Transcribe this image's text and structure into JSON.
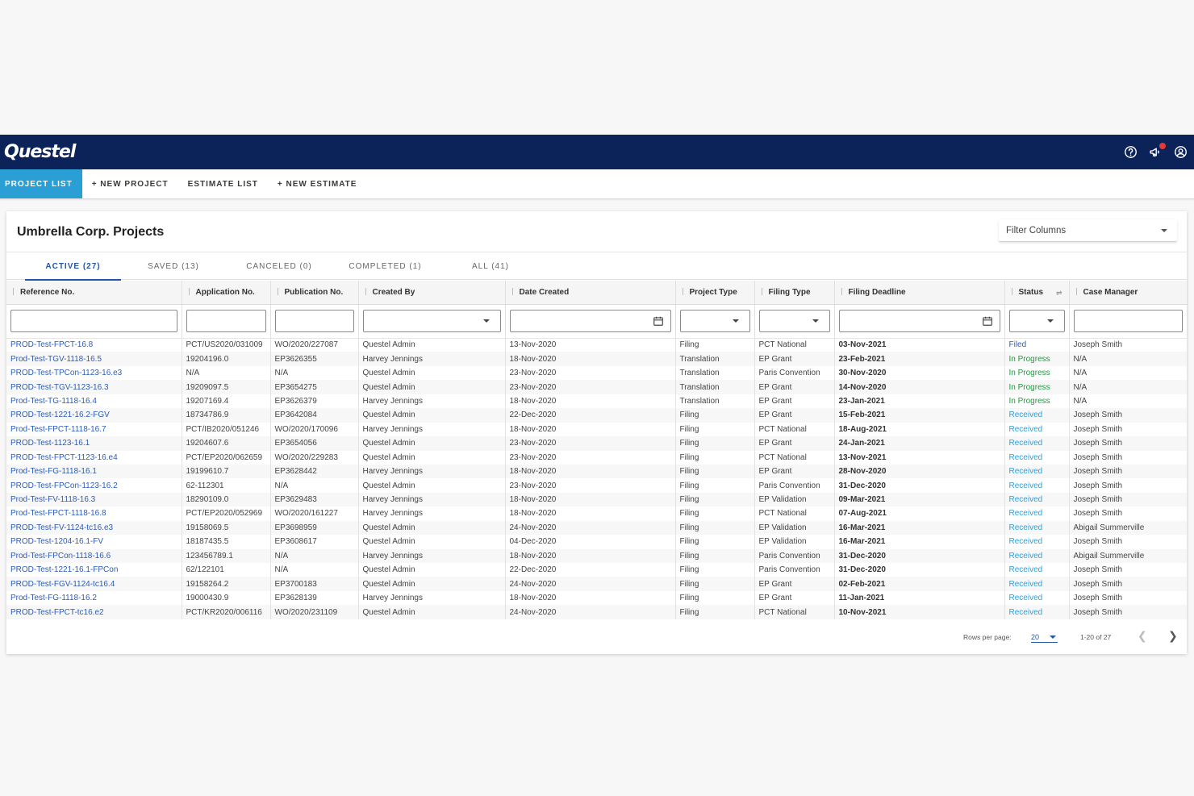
{
  "app": {
    "logo": "Questel"
  },
  "topbar": {
    "help_icon": "help-circle-icon",
    "announce_icon": "megaphone-icon",
    "account_icon": "account-circle-icon"
  },
  "nav": {
    "items": [
      {
        "label": "Project List",
        "active": true
      },
      {
        "label": "+ New Project",
        "active": false
      },
      {
        "label": "Estimate List",
        "active": false
      },
      {
        "label": "+ New Estimate",
        "active": false
      }
    ]
  },
  "page": {
    "title": "Umbrella Corp. Projects",
    "filter_columns": "Filter Columns"
  },
  "tabs": [
    {
      "label": "Active (27)",
      "active": true
    },
    {
      "label": "Saved (13)",
      "active": false
    },
    {
      "label": "Canceled (0)",
      "active": false
    },
    {
      "label": "Completed (1)",
      "active": false
    },
    {
      "label": "All (41)",
      "active": false
    }
  ],
  "columns": [
    "Reference No.",
    "Application No.",
    "Publication No.",
    "Created By",
    "Date Created",
    "Project Type",
    "Filing Type",
    "Filing Deadline",
    "Status",
    "Case Manager"
  ],
  "rows": [
    [
      "PROD-Test-FPCT-16.8",
      "PCT/US2020/031009",
      "WO/2020/227087",
      "Questel Admin",
      "13-Nov-2020",
      "Filing",
      "PCT National",
      "03-Nov-2021",
      "Filed",
      "Joseph Smith"
    ],
    [
      "Prod-Test-TGV-1118-16.5",
      "19204196.0",
      "EP3626355",
      "Harvey Jennings",
      "18-Nov-2020",
      "Translation",
      "EP Grant",
      "23-Feb-2021",
      "In Progress",
      "N/A"
    ],
    [
      "PROD-Test-TPCon-1123-16.e3",
      "N/A",
      "N/A",
      "Questel Admin",
      "23-Nov-2020",
      "Translation",
      "Paris Convention",
      "30-Nov-2020",
      "In Progress",
      "N/A"
    ],
    [
      "PROD-Test-TGV-1123-16.3",
      "19209097.5",
      "EP3654275",
      "Questel Admin",
      "23-Nov-2020",
      "Translation",
      "EP Grant",
      "14-Nov-2020",
      "In Progress",
      "N/A"
    ],
    [
      "Prod-Test-TG-1118-16.4",
      "19207169.4",
      "EP3626379",
      "Harvey Jennings",
      "18-Nov-2020",
      "Translation",
      "EP Grant",
      "23-Jan-2021",
      "In Progress",
      "N/A"
    ],
    [
      "PROD-Test-1221-16.2-FGV",
      "18734786.9",
      "EP3642084",
      "Questel Admin",
      "22-Dec-2020",
      "Filing",
      "EP Grant",
      "15-Feb-2021",
      "Received",
      "Joseph Smith"
    ],
    [
      "Prod-Test-FPCT-1118-16.7",
      "PCT/IB2020/051246",
      "WO/2020/170096",
      "Harvey Jennings",
      "18-Nov-2020",
      "Filing",
      "PCT National",
      "18-Aug-2021",
      "Received",
      "Joseph Smith"
    ],
    [
      "PROD-Test-1123-16.1",
      "19204607.6",
      "EP3654056",
      "Questel Admin",
      "23-Nov-2020",
      "Filing",
      "EP Grant",
      "24-Jan-2021",
      "Received",
      "Joseph Smith"
    ],
    [
      "PROD-Test-FPCT-1123-16.e4",
      "PCT/EP2020/062659",
      "WO/2020/229283",
      "Questel Admin",
      "23-Nov-2020",
      "Filing",
      "PCT National",
      "13-Nov-2021",
      "Received",
      "Joseph Smith"
    ],
    [
      "Prod-Test-FG-1118-16.1",
      "19199610.7",
      "EP3628442",
      "Harvey Jennings",
      "18-Nov-2020",
      "Filing",
      "EP Grant",
      "28-Nov-2020",
      "Received",
      "Joseph Smith"
    ],
    [
      "PROD-Test-FPCon-1123-16.2",
      "62-112301",
      "N/A",
      "Questel Admin",
      "23-Nov-2020",
      "Filing",
      "Paris Convention",
      "31-Dec-2020",
      "Received",
      "Joseph Smith"
    ],
    [
      "Prod-Test-FV-1118-16.3",
      "18290109.0",
      "EP3629483",
      "Harvey Jennings",
      "18-Nov-2020",
      "Filing",
      "EP Validation",
      "09-Mar-2021",
      "Received",
      "Joseph Smith"
    ],
    [
      "Prod-Test-FPCT-1118-16.8",
      "PCT/EP2020/052969",
      "WO/2020/161227",
      "Harvey Jennings",
      "18-Nov-2020",
      "Filing",
      "PCT National",
      "07-Aug-2021",
      "Received",
      "Joseph Smith"
    ],
    [
      "PROD-Test-FV-1124-tc16.e3",
      "19158069.5",
      "EP3698959",
      "Questel Admin",
      "24-Nov-2020",
      "Filing",
      "EP Validation",
      "16-Mar-2021",
      "Received",
      "Abigail Summerville"
    ],
    [
      "PROD-Test-1204-16.1-FV",
      "18187435.5",
      "EP3608617",
      "Questel Admin",
      "04-Dec-2020",
      "Filing",
      "EP Validation",
      "16-Mar-2021",
      "Received",
      "Joseph Smith"
    ],
    [
      "Prod-Test-FPCon-1118-16.6",
      "123456789.1",
      "N/A",
      "Harvey Jennings",
      "18-Nov-2020",
      "Filing",
      "Paris Convention",
      "31-Dec-2020",
      "Received",
      "Abigail Summerville"
    ],
    [
      "PROD-Test-1221-16.1-FPCon",
      "62/122101",
      "N/A",
      "Questel Admin",
      "22-Dec-2020",
      "Filing",
      "Paris Convention",
      "31-Dec-2020",
      "Received",
      "Joseph Smith"
    ],
    [
      "PROD-Test-FGV-1124-tc16.4",
      "19158264.2",
      "EP3700183",
      "Questel Admin",
      "24-Nov-2020",
      "Filing",
      "EP Grant",
      "02-Feb-2021",
      "Received",
      "Joseph Smith"
    ],
    [
      "Prod-Test-FG-1118-16.2",
      "19000430.9",
      "EP3628139",
      "Harvey Jennings",
      "18-Nov-2020",
      "Filing",
      "EP Grant",
      "11-Jan-2021",
      "Received",
      "Joseph Smith"
    ],
    [
      "PROD-Test-FPCT-tc16.e2",
      "PCT/KR2020/006116",
      "WO/2020/231109",
      "Questel Admin",
      "24-Nov-2020",
      "Filing",
      "PCT National",
      "10-Nov-2021",
      "Received",
      "Joseph Smith"
    ]
  ],
  "pagination": {
    "rows_per_page_label": "Rows per page:",
    "rows_per_page": "20",
    "range": "1-20 of 27"
  },
  "colors": {
    "topbar": "#0c2359",
    "nav_active": "#2a9fd6",
    "link": "#2b5cb8",
    "status_in_progress": "#1e9a3c",
    "status_received": "#2aa0dc"
  }
}
